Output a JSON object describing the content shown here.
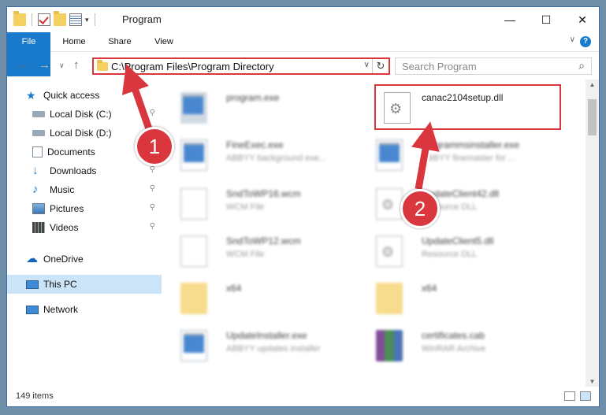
{
  "window": {
    "title": "Program",
    "controls": {
      "minimize": "—",
      "maximize": "☐",
      "close": "✕"
    }
  },
  "ribbon": {
    "tabs": [
      "File",
      "Home",
      "Share",
      "View"
    ],
    "help": "?"
  },
  "address": {
    "path": "C:\\Program Files\\Program Directory",
    "search_placeholder": "Search Program"
  },
  "nav": {
    "items": [
      {
        "label": "Quick access",
        "icon": "star-icon"
      },
      {
        "label": "Local Disk (C:)",
        "icon": "drive-icon",
        "pinned": true
      },
      {
        "label": "Local Disk (D:)",
        "icon": "drive-icon"
      },
      {
        "label": "Documents",
        "icon": "documents-icon",
        "pinned": true
      },
      {
        "label": "Downloads",
        "icon": "download-icon",
        "pinned": true
      },
      {
        "label": "Music",
        "icon": "music-icon",
        "pinned": true
      },
      {
        "label": "Pictures",
        "icon": "pictures-icon",
        "pinned": true
      },
      {
        "label": "Videos",
        "icon": "videos-icon",
        "pinned": true
      },
      {
        "label": "OneDrive",
        "icon": "cloud-icon"
      },
      {
        "label": "This PC",
        "icon": "computer-icon",
        "selected": true
      },
      {
        "label": "Network",
        "icon": "network-icon"
      }
    ]
  },
  "files": [
    {
      "name": "program.exe",
      "desc": "",
      "icon": "exe-icon"
    },
    {
      "name": "canac2104setup.dll",
      "desc": "",
      "icon": "dll-icon"
    },
    {
      "name": "FineExec.exe",
      "desc": "ABBYY background exe...",
      "icon": "exe-icon"
    },
    {
      "name": "programmsinstaller.exe",
      "desc": "ABBYY finemaster for ...",
      "icon": "exe-icon"
    },
    {
      "name": "SndToWP16.wcm",
      "desc": "WCM File",
      "icon": "doc-icon"
    },
    {
      "name": "UpdateClient42.dll",
      "desc": "Resource DLL",
      "icon": "dll-icon"
    },
    {
      "name": "SndToWP12.wcm",
      "desc": "WCM File",
      "icon": "doc-icon"
    },
    {
      "name": "UpdateClient5.dll",
      "desc": "Resource DLL",
      "icon": "dll-icon"
    },
    {
      "name": "x64",
      "desc": "",
      "icon": "folder-icon"
    },
    {
      "name": "x64",
      "desc": "",
      "icon": "folder-icon"
    },
    {
      "name": "UpdateInstaller.exe",
      "desc": "ABBYY updates installer",
      "icon": "exe-icon"
    },
    {
      "name": "certificates.cab",
      "desc": "WinRAR Archive",
      "icon": "archive-icon"
    }
  ],
  "annotations": {
    "step1": "1",
    "step2": "2"
  },
  "status": {
    "count": "149 items"
  },
  "colors": {
    "accent": "#1979ca",
    "annotation": "#d9363e",
    "selected": "#cce4f7"
  }
}
